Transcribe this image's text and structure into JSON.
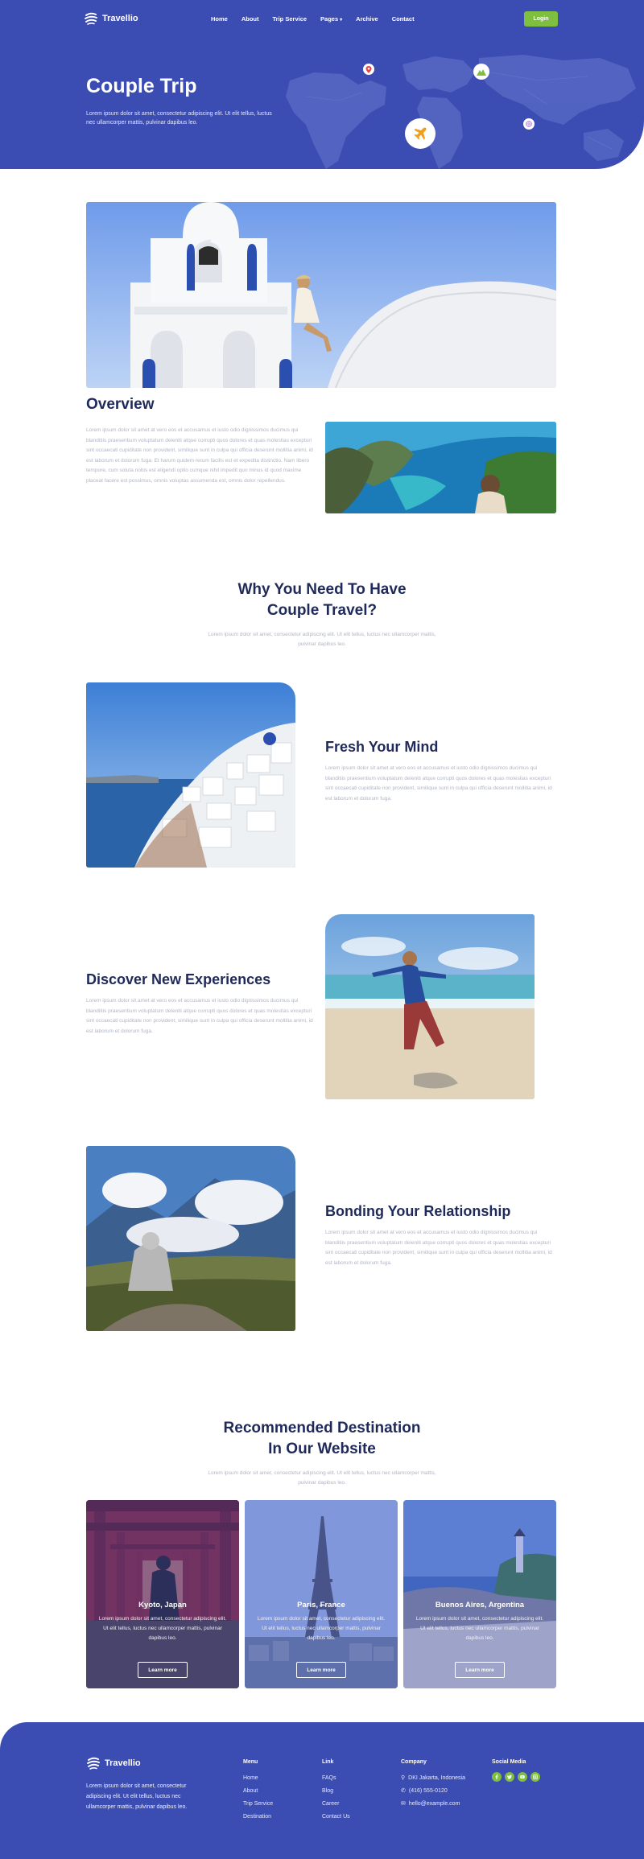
{
  "brand": {
    "name": "Travellio",
    "accent": "#3b4cb3",
    "green": "#7fbf3f"
  },
  "nav": {
    "items": [
      "Home",
      "About",
      "Trip Service",
      "Pages",
      "Archive",
      "Contact"
    ],
    "login": "Login"
  },
  "hero": {
    "title": "Couple Trip",
    "subtitle": "Lorem ipsum dolor sit amet, consectetur adipiscing elit. Ut elit tellus, luctus nec ullamcorper mattis, pulvinar dapibus leo."
  },
  "overview": {
    "title": "Overview",
    "text": "Lorem ipsum dolor sit amet at vero eos et accusamus et iusto odio dignissimos ducimus qui blanditiis praesentium voluptatum deleniti atque corrupti quos dolores et quas molestias excepturi sint occaecati cupiditate non provident, similique sunt in culpa qui officia deserunt mollitia animi, id est laborum et dolorum fuga. Et harum quidem rerum facilis est et expedita distinctio. Nam libero tempore, cum soluta nobis est eligendi optio cumque nihil impedit quo minus id quod maxime placeat facere est possimus, omnis voluptas assumenda est, omnis dolor repellendus."
  },
  "why": {
    "title_line1": "Why You Need To Have",
    "title_line2": "Couple Travel?",
    "text": "Lorem ipsum dolor sit amet, consectetur adipiscing elit. Ut elit tellus, luctus nec ullamcorper mattis, pulvinar dapibus leo."
  },
  "features": [
    {
      "title": "Fresh Your Mind",
      "text": "Lorem ipsum dolor sit amet at vero eos et accusamus et iusto odio dignissimos ducimus qui blanditiis praesentium voluptatum deleniti atque corrupti quos dolores et quas molestias excepturi sint occaecati cupiditate non provident, similique sunt in culpa qui officia deserunt mollitia animi, id est laborum et dolorum fuga."
    },
    {
      "title": "Discover New Experiences",
      "text": "Lorem ipsum dolor sit amet at vero eos et accusamus et iusto odio dignissimos ducimus qui blanditiis praesentium voluptatum deleniti atque corrupti quos dolores et quas molestias excepturi sint occaecati cupiditate non provident, similique sunt in culpa qui officia deserunt mollitia animi, id est laborum et dolorum fuga."
    },
    {
      "title": "Bonding Your Relationship",
      "text": "Lorem ipsum dolor sit amet at vero eos et accusamus et iusto odio dignissimos ducimus qui blanditiis praesentium voluptatum deleniti atque corrupti quos dolores et quas molestias excepturi sint occaecati cupiditate non provident, similique sunt in culpa qui officia deserunt mollitia animi, id est laborum et dolorum fuga."
    }
  ],
  "recommended": {
    "title_line1": "Recommended Destination",
    "title_line2": "In Our Website",
    "text": "Lorem ipsum dolor sit amet, consectetur adipiscing elit. Ut elit tellus, luctus nec ullamcorper mattis, pulvinar dapibus leo.",
    "cards": [
      {
        "title": "Kyoto, Japan",
        "text": "Lorem ipsum dolor sit amet, consectetur adipiscing elit. Ut elit tellus, luctus nec ullamcorper mattis, pulvinar dapibus leo.",
        "button": "Learn more"
      },
      {
        "title": "Paris, France",
        "text": "Lorem ipsum dolor sit amet, consectetur adipiscing elit. Ut elit tellus, luctus nec ullamcorper mattis, pulvinar dapibus leo.",
        "button": "Learn more"
      },
      {
        "title": "Buenos Aires, Argentina",
        "text": "Lorem ipsum dolor sit amet, consectetur adipiscing elit. Ut elit tellus, luctus nec ullamcorper mattis, pulvinar dapibus leo.",
        "button": "Learn more"
      }
    ]
  },
  "footer": {
    "about": "Lorem ipsum dolor sit amet, consectetur adipiscing elit. Ut elit tellus, luctus nec ullamcorper mattis, pulvinar dapibus leo.",
    "menu": {
      "title": "Menu",
      "items": [
        "Home",
        "About",
        "Trip Service",
        "Destination"
      ]
    },
    "link": {
      "title": "Link",
      "items": [
        "FAQs",
        "Blog",
        "Career",
        "Contact Us"
      ]
    },
    "company": {
      "title": "Company",
      "address": "DKI Jakarta, Indonesia",
      "phone": "(416) 555-0120",
      "email": "hello@example.com"
    },
    "social": {
      "title": "Social Media",
      "icons": [
        "facebook-icon",
        "twitter-icon",
        "youtube-icon",
        "instagram-icon"
      ]
    }
  }
}
